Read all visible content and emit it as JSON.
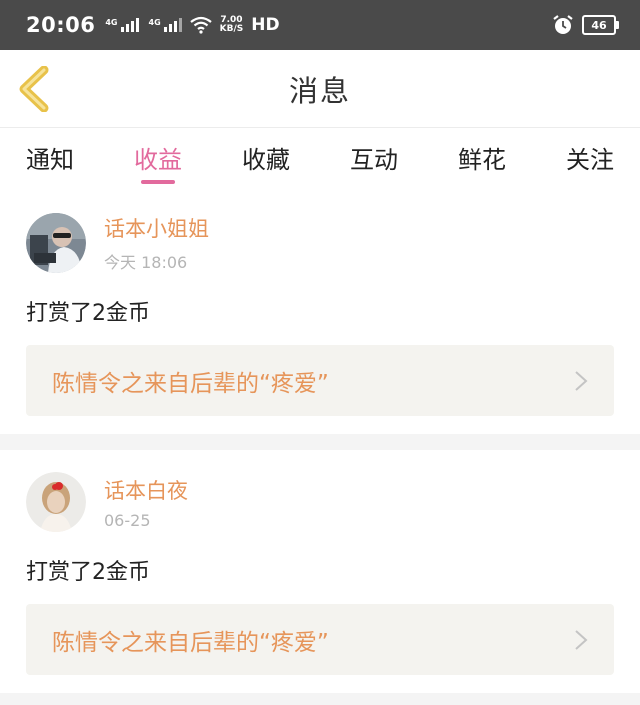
{
  "status_bar": {
    "time": "20:06",
    "network_tag": "4G",
    "speed_value": "7.00",
    "speed_unit": "KB/S",
    "hd_label": "HD",
    "battery": "46"
  },
  "header": {
    "title": "消息"
  },
  "tabs": [
    {
      "label": "通知"
    },
    {
      "label": "收益",
      "active": true
    },
    {
      "label": "收藏"
    },
    {
      "label": "互动"
    },
    {
      "label": "鲜花"
    },
    {
      "label": "关注"
    }
  ],
  "notifications": [
    {
      "username": "话本小姐姐",
      "time": "今天 18:06",
      "message": "打赏了2金币",
      "link_text": "陈情令之来自后辈的“疼爱”"
    },
    {
      "username": "话本白夜",
      "time": "06-25",
      "message": "打赏了2金币",
      "link_text": "陈情令之来自后辈的“疼爱”"
    }
  ],
  "colors": {
    "accent_pink": "#e26a9d",
    "accent_orange": "#e6955a",
    "back_arrow": "#e8c24a"
  }
}
